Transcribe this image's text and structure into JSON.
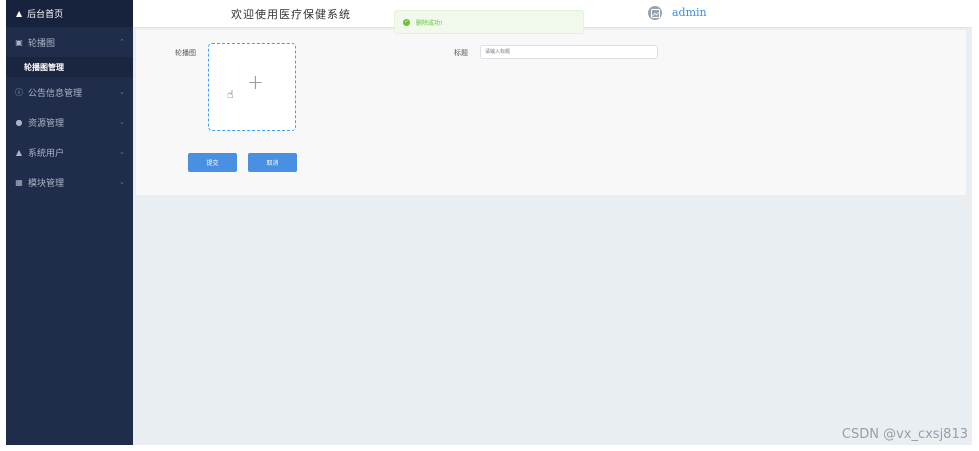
{
  "sidebar": {
    "home_label": "后台首页",
    "menus": [
      {
        "icon": "image-icon",
        "label": "轮播图"
      },
      {
        "icon": "info-icon",
        "label": "公告信息管理"
      },
      {
        "icon": "location-icon",
        "label": "资源管理"
      },
      {
        "icon": "user-icon",
        "label": "系统用户"
      },
      {
        "icon": "grid-icon",
        "label": "模块管理"
      }
    ],
    "submenu": {
      "label": "轮播图管理"
    }
  },
  "header": {
    "welcome": "欢迎使用医疗保健系统",
    "username": "admin"
  },
  "toast": {
    "message": "删除成功!"
  },
  "form": {
    "image_label": "轮播图",
    "title_label": "标题",
    "title_placeholder": "请输入标题",
    "submit_label": "提交",
    "cancel_label": "取消"
  },
  "watermark": "CSDN @vx_cxsj813",
  "colors": {
    "sidebar_bg": "#1f2d4a",
    "accent": "#4a90e2",
    "success": "#67c23a"
  }
}
